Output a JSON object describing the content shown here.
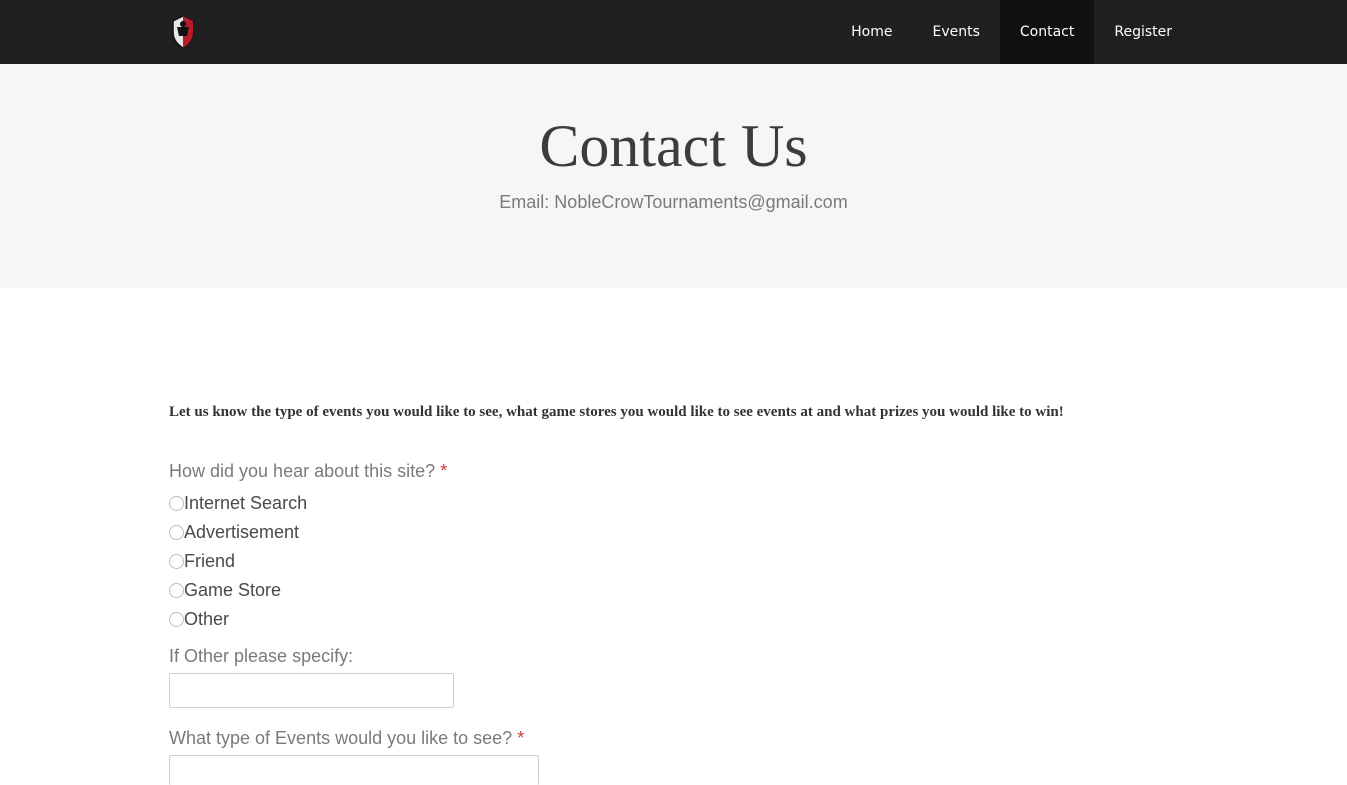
{
  "nav": {
    "items": [
      {
        "label": "Home"
      },
      {
        "label": "Events"
      },
      {
        "label": "Contact"
      },
      {
        "label": "Register"
      }
    ]
  },
  "hero": {
    "title": "Contact Us",
    "email": "Email: NobleCrowTournaments@gmail.com"
  },
  "form": {
    "intro": "Let us know the type of events you would like to see, what game stores you would like to see events at and what prizes you would like to win!",
    "q1": {
      "label": "How did you hear about this site?",
      "required_mark": "*",
      "options": [
        "Internet Search",
        "Advertisement",
        "Friend",
        "Game Store",
        "Other"
      ]
    },
    "q2": {
      "label": "If Other please specify:",
      "value": ""
    },
    "q3": {
      "label": "What type of Events would you like to see?",
      "required_mark": "*",
      "value": ""
    }
  },
  "colors": {
    "navbar": "#202020",
    "hero_bg": "#f6f6f6",
    "required": "#d03a3a"
  }
}
